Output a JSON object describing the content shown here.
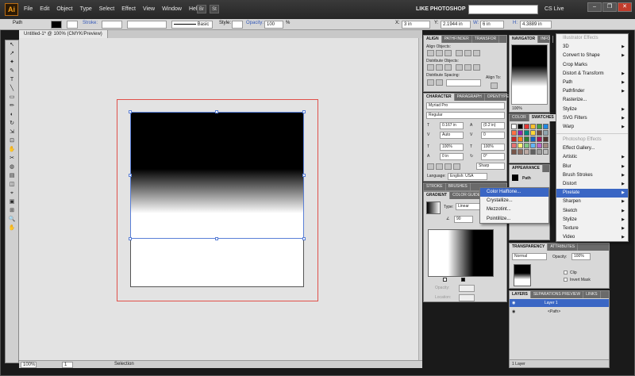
{
  "app": {
    "logo": "Ai",
    "menus": [
      "File",
      "Edit",
      "Object",
      "Type",
      "Select",
      "Effect",
      "View",
      "Window",
      "Help"
    ],
    "bridge_icons": [
      "Br",
      "St"
    ],
    "workspace": "LIKE PHOTOSHOP",
    "cs_live": "CS Live",
    "window_buttons": [
      "–",
      "❐",
      "✕"
    ]
  },
  "control_bar": {
    "object_type": "Path",
    "stroke_label": "Stroke:",
    "stroke_profile": "Basic",
    "style_label": "Style:",
    "opacity_label": "Opacity:",
    "opacity_value": "100",
    "opacity_unit": "%",
    "x_label": "X:",
    "x_value": "3 in",
    "y_label": "Y:",
    "y_value": "2.1944 in",
    "w_label": "W:",
    "w_value": "6 in",
    "h_label": "H:",
    "h_value": "4.3889 in"
  },
  "document": {
    "tab_label": "Untitled-1* @ 100% (CMYK/Preview)",
    "zoom": "100%",
    "page_num": "1",
    "status": "Selection"
  },
  "tools": [
    "↖",
    "↗",
    "✦",
    "✎",
    "T",
    "╲",
    "▭",
    "✏",
    "◐",
    "↻",
    "⇲",
    "⊡",
    "✋",
    "✂",
    "◍",
    "▤",
    "◫",
    "⌖",
    "▣",
    "⊞",
    "🔍",
    "✋"
  ],
  "align_panel": {
    "tabs": [
      "ALIGN",
      "PATHFINDER",
      "TRANSFOR"
    ],
    "align_objects": "Align Objects:",
    "distribute_objects": "Distribute Objects:",
    "distribute_spacing": "Distribute Spacing:",
    "align_to": "Align To:"
  },
  "character_panel": {
    "tabs": [
      "CHARACTER",
      "PARAGRAPH",
      "OPENTYPE"
    ],
    "font": "Myriad Pro",
    "style": "Regular",
    "size": "0.167 in",
    "leading": "(0.2 in)",
    "kerning": "Auto",
    "tracking": "0",
    "vscale": "100%",
    "hscale": "100%",
    "baseline": "0 in",
    "rotation": "0°",
    "antialias": "Sharp",
    "language_label": "Language:",
    "language": "English: USA"
  },
  "gradient_panel": {
    "tabs": [
      "STROKE",
      "BRUSHES"
    ],
    "tabs2": [
      "GRADIENT",
      "COLOR GUIDE"
    ],
    "type_label": "Type:",
    "type_value": "Linear",
    "angle": "90",
    "opacity_label": "Opacity:",
    "location_label": "Location:"
  },
  "navigator_panel": {
    "tabs": [
      "NAVIGATOR",
      "INFO"
    ],
    "zoom": "100%"
  },
  "color_panel": {
    "tabs": [
      "COLOR",
      "SWATCHES"
    ],
    "swatches": [
      "#ffffff",
      "#000000",
      "#e53935",
      "#fbc02d",
      "#43a047",
      "#1e88e5",
      "#ff7043",
      "#8e24aa",
      "#00897b",
      "#fdd835",
      "#6d4c41",
      "#90a4ae",
      "#c62828",
      "#f57f17",
      "#2e7d32",
      "#1565c0",
      "#ad1457",
      "#4e342e",
      "#e57373",
      "#fff176",
      "#81c784",
      "#64b5f6",
      "#ba68c8",
      "#a1887f",
      "#795548",
      "#8d6e63",
      "#bcaaa4",
      "#616161",
      "#9e9e9e",
      "#bdbdbd"
    ]
  },
  "appearance_panel": {
    "tabs": [
      "APPEARANCE",
      "GRAPHIC STYLES"
    ],
    "item": "Path"
  },
  "transparency_panel": {
    "tabs": [
      "TRANSPARENCY",
      "ATTRIBUTES"
    ],
    "mode": "Normal",
    "opacity_label": "Opacity:",
    "opacity": "100%",
    "clip": "Clip",
    "invert_mask": "Invert Mask"
  },
  "layers_panel": {
    "tabs": [
      "LAYERS",
      "SEPARATIONS PREVIEW",
      "LINKS"
    ],
    "layer_name": "Layer 1",
    "sublayer_name": "<Path>",
    "count": "1 Layer"
  },
  "effect_menu": {
    "illustrator_header": "Illustrator Effects",
    "illustrator_items": [
      "3D",
      "Convert to Shape",
      "Crop Marks",
      "Distort & Transform",
      "Path",
      "Pathfinder",
      "Rasterize...",
      "Stylize",
      "SVG Filters",
      "Warp"
    ],
    "illustrator_arrows": [
      true,
      true,
      false,
      true,
      true,
      true,
      false,
      true,
      true,
      true
    ],
    "photoshop_header": "Photoshop Effects",
    "photoshop_items": [
      "Effect Gallery...",
      "Artistic",
      "Blur",
      "Brush Strokes",
      "Distort",
      "Pixelate",
      "Sharpen",
      "Sketch",
      "Stylize",
      "Texture",
      "Video"
    ],
    "photoshop_arrows": [
      false,
      true,
      true,
      true,
      true,
      true,
      true,
      true,
      true,
      true,
      true
    ],
    "selected": "Pixelate"
  },
  "pixelate_menu": {
    "items": [
      "Color Halftone...",
      "Crystallize...",
      "Mezzotint...",
      "Pointillize..."
    ],
    "selected": "Color Halftone..."
  }
}
